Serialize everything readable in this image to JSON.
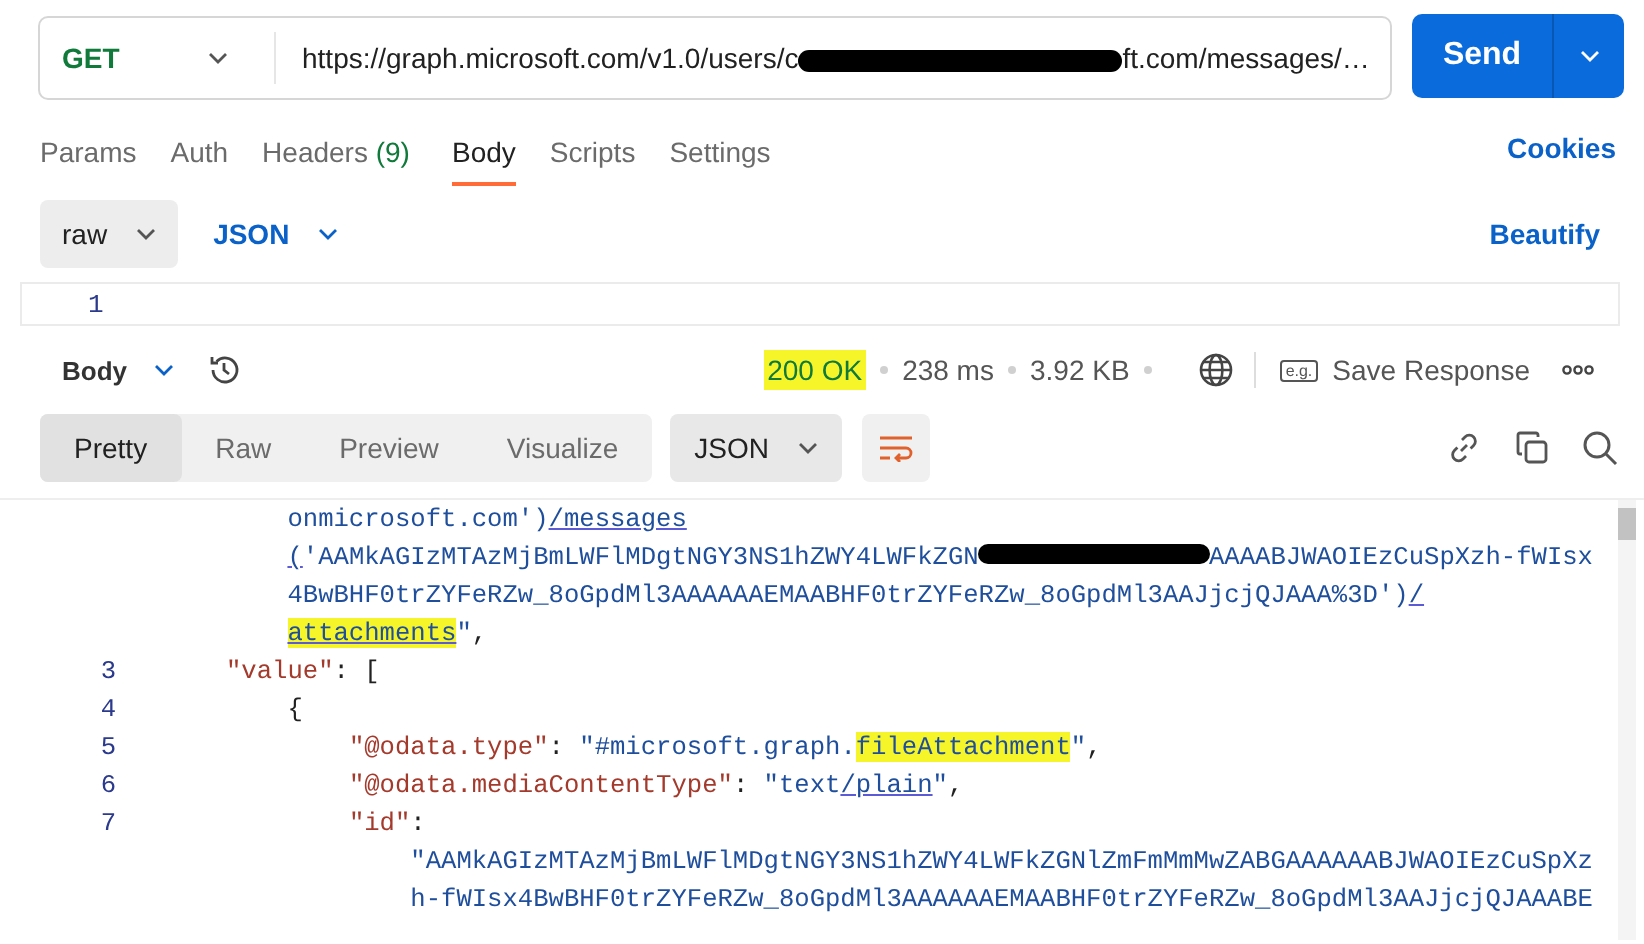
{
  "request": {
    "method": "GET",
    "url_parts": [
      {
        "kind": "text",
        "text": "https://graph.microsoft.com/v1.0/users/c"
      },
      {
        "kind": "redacted"
      },
      {
        "kind": "text",
        "text": "ft.com/messages/…"
      }
    ],
    "send": "Send"
  },
  "tabs": [
    {
      "label": "Params",
      "selected": false
    },
    {
      "label": "Auth",
      "selected": false
    },
    {
      "label": "Headers",
      "count": "(9)",
      "selected": false
    },
    {
      "label": "Body",
      "selected": true
    },
    {
      "label": "Scripts",
      "selected": false
    },
    {
      "label": "Settings",
      "selected": false
    }
  ],
  "cookies": "Cookies",
  "body_options": {
    "mode": "raw",
    "language": "JSON",
    "beautify": "Beautify"
  },
  "editor": {
    "line_numbers": [
      "1"
    ]
  },
  "response": {
    "view": "Body",
    "status": {
      "text": "200 OK",
      "highlighted": true
    },
    "time": "238 ms",
    "size": "3.92 KB",
    "save_badge": "e.g.",
    "save": "Save Response",
    "view_tabs": [
      {
        "label": "Pretty",
        "selected": true
      },
      {
        "label": "Raw",
        "selected": false
      },
      {
        "label": "Preview",
        "selected": false
      },
      {
        "label": "Visualize",
        "selected": false
      }
    ],
    "format": "JSON",
    "code_lines": [
      {
        "segments": [
          {
            "kind": "str",
            "text": "    onmicrosoft.com')"
          },
          {
            "kind": "link",
            "text": "/messages"
          }
        ]
      },
      {
        "segments": [
          {
            "kind": "link",
            "text": "    ("
          },
          {
            "kind": "str",
            "text": "'AAMkAGIzMTAzMjBmLWFlMDgtNGY3NS1hZWY4LWFkZGN"
          },
          {
            "kind": "redacted"
          },
          {
            "kind": "str",
            "text": "AAAABJWAOIEzCuSpXzh-fWIsx"
          }
        ]
      },
      {
        "segments": [
          {
            "kind": "str",
            "text": "    4BwBHF0trZYFeRZw_8oGpdMl3AAAAAAEMAABHF0trZYFeRZw_8oGpdMl3AAJjcjQJAAA%3D')"
          },
          {
            "kind": "link",
            "text": "/"
          }
        ]
      },
      {
        "segments": [
          {
            "kind": "marked-link",
            "text": "    attachments"
          },
          {
            "kind": "str",
            "text": "\""
          },
          {
            "kind": "punct",
            "text": ","
          }
        ]
      },
      {
        "number": "3",
        "segments": [
          {
            "kind": "key",
            "text": "\"value\""
          },
          {
            "kind": "punct",
            "text": ": ["
          }
        ]
      },
      {
        "number": "4",
        "segments": [
          {
            "kind": "punct",
            "text": "    {"
          }
        ]
      },
      {
        "number": "5",
        "segments": [
          {
            "kind": "key",
            "text": "        \"@odata.type\""
          },
          {
            "kind": "punct",
            "text": ": "
          },
          {
            "kind": "str",
            "text": "\"#microsoft.graph."
          },
          {
            "kind": "marked",
            "text": "fileAttachment"
          },
          {
            "kind": "str",
            "text": "\""
          },
          {
            "kind": "punct",
            "text": ","
          }
        ]
      },
      {
        "number": "6",
        "segments": [
          {
            "kind": "key",
            "text": "        \"@odata.mediaContentType\""
          },
          {
            "kind": "punct",
            "text": ": "
          },
          {
            "kind": "str",
            "text": "\"text"
          },
          {
            "kind": "link",
            "text": "/plain"
          },
          {
            "kind": "str",
            "text": "\""
          },
          {
            "kind": "punct",
            "text": ","
          }
        ]
      },
      {
        "number": "7",
        "segments": [
          {
            "kind": "key",
            "text": "        \"id\""
          },
          {
            "kind": "punct",
            "text": ":"
          }
        ]
      },
      {
        "segments": [
          {
            "kind": "str",
            "text": "            \"AAMkAGIzMTAzMjBmLWFlMDgtNGY3NS1hZWY4LWFkZGNlZmFmMmMwZABGAAAAAABJWAOIEzCuSpXz"
          }
        ]
      },
      {
        "segments": [
          {
            "kind": "str",
            "text": "            h-fWIsx4BwBHF0trZYFeRZw_8oGpdMl3AAAAAAEMAABHF0trZYFeRZw_8oGpdMl3AAJjcjQJAAABE"
          }
        ]
      }
    ]
  }
}
